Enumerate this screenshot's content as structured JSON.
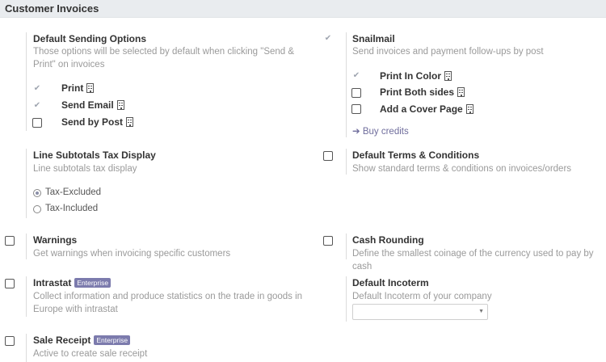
{
  "header": {
    "title": "Customer Invoices"
  },
  "default_sending": {
    "title": "Default Sending Options",
    "desc_line1": "Those options will be selected by default when clicking \"Send &",
    "desc_line2": "Print\" on invoices",
    "options": [
      {
        "label": "Print",
        "checked": true
      },
      {
        "label": "Send Email",
        "checked": true
      },
      {
        "label": "Send by Post",
        "checked": false
      }
    ]
  },
  "snailmail": {
    "title": "Snailmail",
    "desc": "Send invoices and payment follow-ups by post",
    "checked": true,
    "options": [
      {
        "label": "Print In Color",
        "checked": true
      },
      {
        "label": "Print Both sides",
        "checked": false
      },
      {
        "label": "Add a Cover Page",
        "checked": false
      }
    ],
    "buy_credits": "Buy credits"
  },
  "line_subtotals": {
    "title": "Line Subtotals Tax Display",
    "desc": "Line subtotals tax display",
    "options": [
      {
        "label": "Tax-Excluded",
        "selected": true
      },
      {
        "label": "Tax-Included",
        "selected": false
      }
    ]
  },
  "default_terms": {
    "title": "Default Terms & Conditions",
    "desc": "Show standard terms & conditions on invoices/orders",
    "checked": false
  },
  "warnings": {
    "title": "Warnings",
    "desc": "Get warnings when invoicing specific customers",
    "checked": false
  },
  "cash_rounding": {
    "title": "Cash Rounding",
    "desc": "Define the smallest coinage of the currency used to pay by cash",
    "checked": false
  },
  "intrastat": {
    "title": "Intrastat",
    "badge": "Enterprise",
    "desc_line1": "Collect information and produce statistics on the trade in goods in",
    "desc_line2": "Europe with intrastat",
    "checked": false
  },
  "default_incoterm": {
    "title": "Default Incoterm",
    "desc": "Default Incoterm of your company",
    "value": ""
  },
  "sale_receipt": {
    "title": "Sale Receipt",
    "badge": "Enterprise",
    "desc": "Active to create sale receipt",
    "checked": false
  }
}
